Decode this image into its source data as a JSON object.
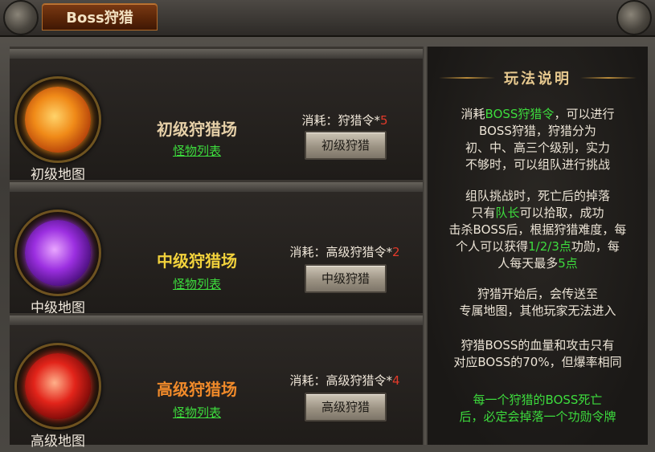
{
  "title": "Boss狩猎",
  "rows": [
    {
      "orb_label": "初级地图",
      "zone_name": "初级狩猎场",
      "zone_color": "#e6d0a8",
      "monster_link": "怪物列表",
      "cost_label": "消耗：狩猎令*",
      "cost_num": "5",
      "button": "初级狩猎",
      "orb_colors": [
        "#ffd36a",
        "#f08a18",
        "#b3400a"
      ]
    },
    {
      "orb_label": "中级地图",
      "zone_name": "中级狩猎场",
      "zone_color": "#f2d23c",
      "monster_link": "怪物列表",
      "cost_label": "消耗：高级狩猎令*",
      "cost_num": "2",
      "button": "中级狩猎",
      "orb_colors": [
        "#e9a6ff",
        "#9b2fe0",
        "#4a0f7d"
      ]
    },
    {
      "orb_label": "高级地图",
      "zone_name": "高级狩猎场",
      "zone_color": "#f08a2a",
      "monster_link": "怪物列表",
      "cost_label": "消耗：高级狩猎令*",
      "cost_num": "4",
      "button": "高级狩猎",
      "orb_colors": [
        "#ffb08a",
        "#e2241a",
        "#7a0a08"
      ]
    }
  ],
  "rules": {
    "title": "玩法说明",
    "p1_a": "消耗",
    "p1_hl": "BOSS狩猎令",
    "p1_b": "，可以进行",
    "p1_l2": "BOSS狩猎，狩猎分为",
    "p1_l3": "初、中、高三个级别，实力",
    "p1_l4": "不够时，可以组队进行挑战",
    "p2_l1": "组队挑战时，死亡后的掉落",
    "p2_a": "只有",
    "p2_hl1": "队长",
    "p2_b": "可以拾取，成功",
    "p2_l3": "击杀BOSS后，根据狩猎难度，每",
    "p2_c": "个人可以获得",
    "p2_hl2": "1/2/3点",
    "p2_d": "功勋，每",
    "p2_e": "人每天最多",
    "p2_hl3": "5点",
    "p3_l1": "狩猎开始后，会传送至",
    "p3_l2": "专属地图，其他玩家无法进入",
    "p4_l1": "狩猎BOSS的血量和攻击只有",
    "p4_l2": "对应BOSS的70%，但爆率相同",
    "p5_l1": "每一个狩猎的BOSS死亡",
    "p5_l2": "后，必定会掉落一个功勋令牌"
  }
}
